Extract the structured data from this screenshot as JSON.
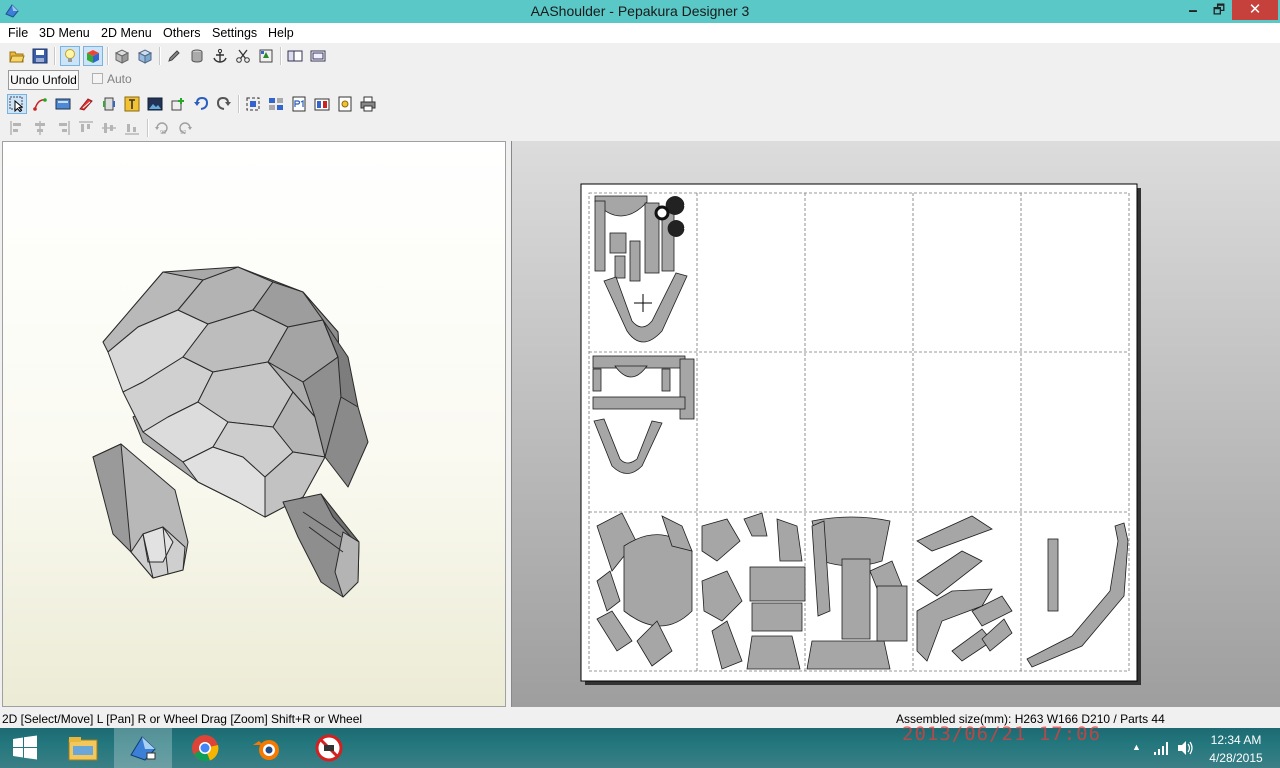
{
  "window": {
    "title": "AAShoulder - Pepakura Designer 3",
    "minimize": "🗕",
    "maximize": "🗗",
    "close": "✕"
  },
  "menu": [
    "File",
    "3D Menu",
    "2D Menu",
    "Others",
    "Settings",
    "Help"
  ],
  "unfold": {
    "button_label": "Undo Unfold",
    "auto_label": "Auto",
    "auto_checked": false
  },
  "status": {
    "left": "2D [Select/Move] L [Pan] R or Wheel Drag [Zoom] Shift+R or Wheel",
    "right": "Assembled size(mm): H263 W166 D210 / Parts 44"
  },
  "taskbar": {
    "clock_time": "12:34 AM",
    "clock_date": "4/28/2015",
    "apps": [
      "file-explorer",
      "pepakura-designer",
      "chrome",
      "blender",
      "blocked-app"
    ],
    "tray_arrow": "▲",
    "stamp_text": "2013/06/21 17:06"
  },
  "colors": {
    "titlebar": "#59c8c7",
    "close_button": "#c7413c",
    "part_fill": "#a6a6a6",
    "taskbar": "#23777d"
  }
}
